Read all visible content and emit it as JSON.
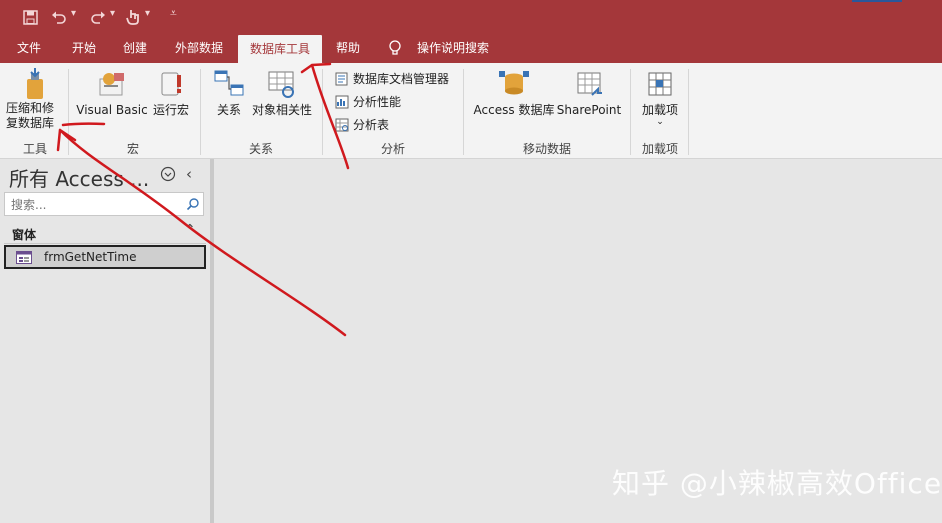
{
  "quick_access": {
    "save_icon": "save-icon",
    "undo_icon": "undo-icon",
    "redo_icon": "redo-icon",
    "touch_icon": "touch-mode-icon",
    "customize_icon": "customize-qat-icon"
  },
  "tabs": [
    {
      "label": "文件"
    },
    {
      "label": "开始"
    },
    {
      "label": "创建"
    },
    {
      "label": "外部数据"
    },
    {
      "label": "数据库工具"
    },
    {
      "label": "帮助"
    },
    {
      "label": "操作说明搜索"
    }
  ],
  "ribbon": {
    "tools": {
      "compact_label_1": "压缩和修",
      "compact_label_2": "复数据库",
      "group": "工具"
    },
    "macro": {
      "vb_label": "Visual Basic",
      "run_macro_label": "运行宏",
      "group": "宏"
    },
    "relationships": {
      "rel_label": "关系",
      "deps_label": "对象相关性",
      "group": "关系"
    },
    "analyze": {
      "documenter": "数据库文档管理器",
      "performance": "分析性能",
      "table": "分析表",
      "group": "分析"
    },
    "move_data": {
      "access_db": "Access 数据库",
      "sharepoint": "SharePoint",
      "group": "移动数据"
    },
    "addins": {
      "label": "加载项",
      "group": "加载项"
    }
  },
  "nav_pane": {
    "title": "所有 Access ...",
    "search_placeholder": "搜索...",
    "section": "窗体",
    "items": [
      {
        "label": "frmGetNetTime"
      }
    ]
  },
  "watermark": "知乎 @小辣椒高效Office",
  "colors": {
    "accent": "#a4373a",
    "annotation": "#d0191e"
  }
}
